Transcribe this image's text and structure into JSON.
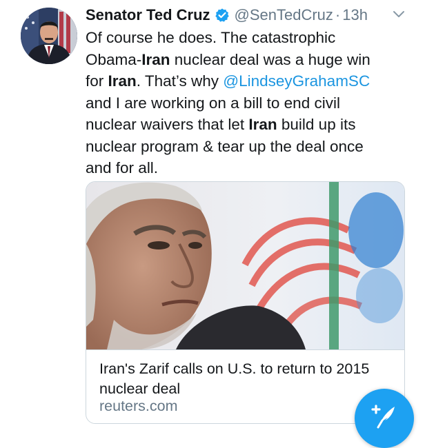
{
  "tweet": {
    "author": {
      "display_name": "Senator Ted Cruz",
      "handle": "@SenTedCruz",
      "verified_icon": "verified-badge-icon",
      "separator": "·",
      "time": "13h"
    },
    "menu_icon": "chevron-down-icon",
    "text_lines": {
      "l1": "Of course he does. The catastrophic",
      "l2_a": "Obama-",
      "l2_b": "Iran",
      "l2_c": " nuclear deal was a huge win",
      "l3_a": "for ",
      "l3_b": "Iran",
      "l3_c": ". That’s why ",
      "l3_mention": "@LindseyGrahamSC",
      "l4": "and I are working on a bill to end civil",
      "l5_a": "nuclear waivers that let ",
      "l5_b": "Iran",
      "l5_c": " build up its",
      "l6": "nuclear program & tear up the deal once",
      "l7": "and for all."
    },
    "card": {
      "title": "Iran's Zarif calls on U.S. to return to 2015 nuclear deal",
      "domain": "reuters.com"
    }
  },
  "compose_button": {
    "icon": "compose-feather-icon"
  },
  "colors": {
    "link": "#1b95e0",
    "secondary_text": "#657786",
    "primary_text": "#14171a",
    "fab": "#1da1f2",
    "border": "#ccd6dd"
  }
}
